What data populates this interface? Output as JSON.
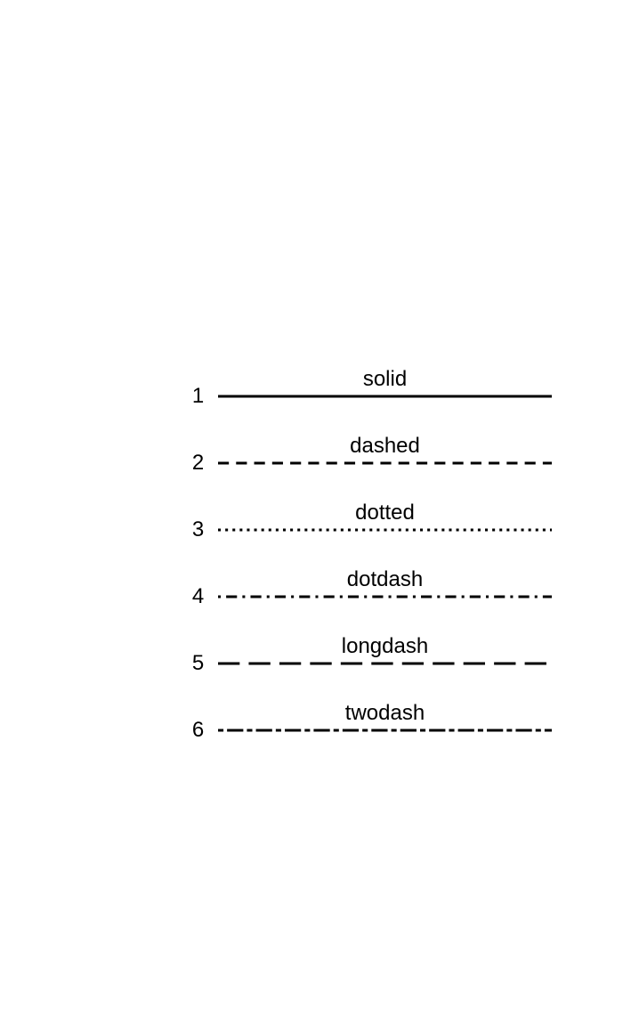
{
  "chart_data": {
    "type": "table",
    "title": "",
    "rows": [
      {
        "index": "1",
        "label": "solid",
        "linetype": "solid"
      },
      {
        "index": "2",
        "label": "dashed",
        "linetype": "dashed"
      },
      {
        "index": "3",
        "label": "dotted",
        "linetype": "dotted"
      },
      {
        "index": "4",
        "label": "dotdash",
        "linetype": "dotdash"
      },
      {
        "index": "5",
        "label": "longdash",
        "linetype": "longdash"
      },
      {
        "index": "6",
        "label": "twodash",
        "linetype": "twodash"
      }
    ]
  },
  "dash_patterns": {
    "solid": "",
    "dashed": "12,8",
    "dotted": "3,5",
    "dotdash": "3,6,12,6",
    "longdash": "24,10",
    "twodash": "6,4,18,4"
  }
}
